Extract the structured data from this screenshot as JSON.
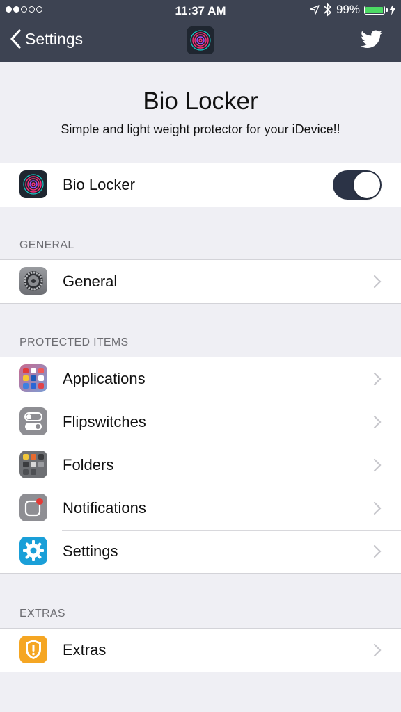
{
  "status_bar": {
    "time": "11:37 AM",
    "battery_percent": "99%",
    "signal_dots_filled": 2,
    "signal_dots_total": 5,
    "battery_level": 0.99,
    "location_icon": "location-arrow-icon",
    "bluetooth_icon": "bluetooth-icon",
    "charging_icon": "charging-bolt-icon"
  },
  "navbar": {
    "back_label": "Settings",
    "center_icon": "fingerprint-app-icon",
    "right_icon": "twitter-icon"
  },
  "header": {
    "title": "Bio Locker",
    "subtitle": "Simple and light weight protector for your iDevice!!"
  },
  "main_toggle": {
    "label": "Bio Locker",
    "icon": "fingerprint-app-icon",
    "enabled": true
  },
  "sections": {
    "general": {
      "header": "GENERAL",
      "items": [
        {
          "label": "General",
          "icon": "gear-icon"
        }
      ]
    },
    "protected": {
      "header": "PROTECTED ITEMS",
      "items": [
        {
          "label": "Applications",
          "icon": "app-grid-icon"
        },
        {
          "label": "Flipswitches",
          "icon": "switches-icon"
        },
        {
          "label": "Folders",
          "icon": "folder-icon"
        },
        {
          "label": "Notifications",
          "icon": "notification-badge-icon"
        },
        {
          "label": "Settings",
          "icon": "settings-gear-icon"
        }
      ]
    },
    "extras": {
      "header": "EXTRAS",
      "items": [
        {
          "label": "Extras",
          "icon": "warning-shield-icon"
        }
      ]
    }
  },
  "colors": {
    "nav_bg": "#3d4352",
    "page_bg": "#efeff4",
    "toggle_on": "#2b3346",
    "battery_green": "#4cd964",
    "settings_blue": "#1a9fd8",
    "extras_orange": "#f5a623"
  }
}
